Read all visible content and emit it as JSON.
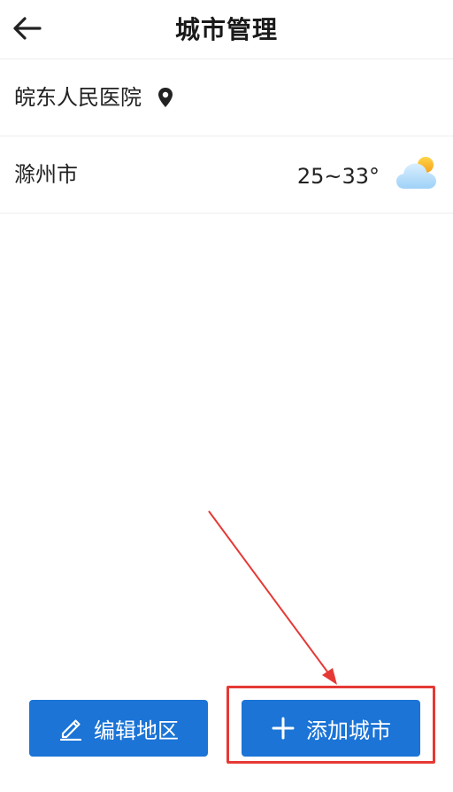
{
  "header": {
    "title": "城市管理",
    "back_icon": "arrow-left-icon"
  },
  "location_row": {
    "label": "皖东人民医院",
    "icon": "location-pin-icon"
  },
  "city_row": {
    "label": "滁州市",
    "temperature": "25~33°",
    "weather_icon": "partly-cloudy-icon"
  },
  "buttons": {
    "edit_label": "编辑地区",
    "edit_icon": "pencil-icon",
    "add_label": "添加城市",
    "add_icon": "plus-icon"
  },
  "colors": {
    "primary": "#1b74d6",
    "annotation": "#e53935"
  }
}
